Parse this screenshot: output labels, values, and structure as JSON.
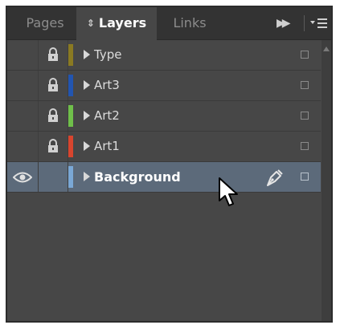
{
  "tabs": {
    "pages": "Pages",
    "layers": "Layers",
    "links": "Links"
  },
  "layers": [
    {
      "name": "Type",
      "color": "#8a7a22",
      "locked": true,
      "visible": false,
      "selected": false
    },
    {
      "name": "Art3",
      "color": "#2255b0",
      "locked": true,
      "visible": false,
      "selected": false
    },
    {
      "name": "Art2",
      "color": "#6fbf4a",
      "locked": true,
      "visible": false,
      "selected": false
    },
    {
      "name": "Art1",
      "color": "#d8452e",
      "locked": true,
      "visible": false,
      "selected": false
    },
    {
      "name": "Background",
      "color": "#7aa8d6",
      "locked": false,
      "visible": true,
      "selected": true
    }
  ],
  "icons": {
    "tab_sort": "up-down-arrows-icon",
    "collapse": "double-arrow-right-icon",
    "panel_menu": "panel-menu-icon",
    "lock": "lock-icon",
    "eye": "eye-icon",
    "pen": "pen-nib-icon",
    "cursor": "mouse-cursor-icon"
  },
  "colors": {
    "panel_bg": "#474747",
    "tabbar_bg": "#333333",
    "selected_row": "#5c6a7a"
  }
}
